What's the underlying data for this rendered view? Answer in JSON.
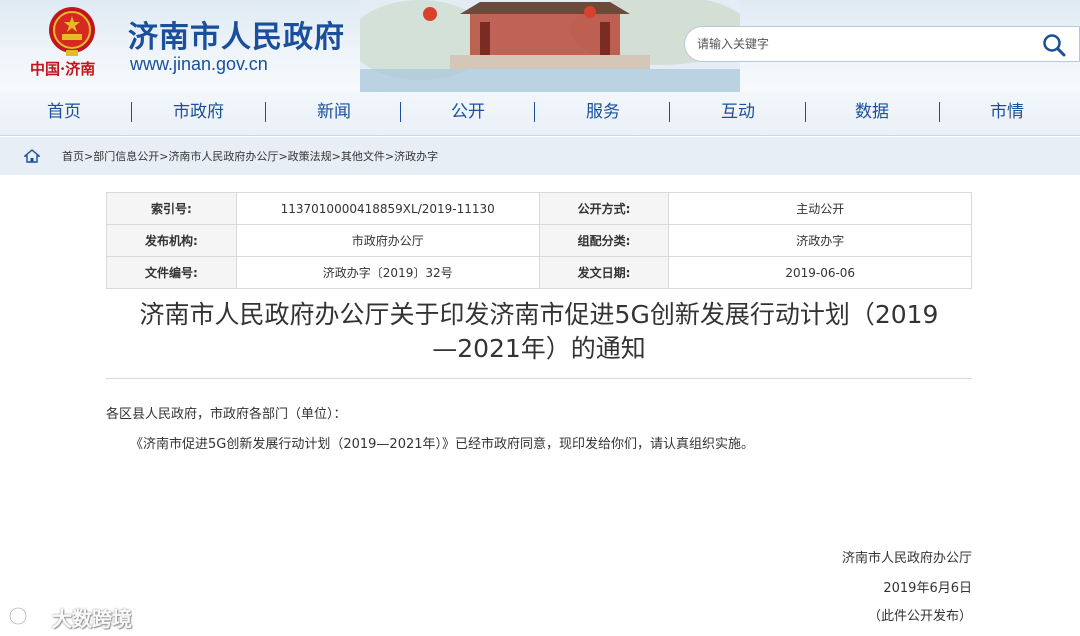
{
  "header": {
    "logo_text": "中国·济南",
    "site_title": "济南市人民政府",
    "site_url": "www.jinan.gov.cn"
  },
  "search": {
    "placeholder": "请输入关键字"
  },
  "nav": {
    "items": [
      {
        "label": "首页"
      },
      {
        "label": "市政府"
      },
      {
        "label": "新闻"
      },
      {
        "label": "公开"
      },
      {
        "label": "服务"
      },
      {
        "label": "互动"
      },
      {
        "label": "数据"
      },
      {
        "label": "市情"
      }
    ]
  },
  "breadcrumb": {
    "items": [
      "首页",
      "部门信息公开",
      "济南市人民政府办公厅",
      "政策法规",
      "其他文件",
      "济政办字"
    ],
    "separator": ">"
  },
  "meta": {
    "rows": [
      {
        "l1": "索引号:",
        "v1": "113701000041885 9XL/2019-11130",
        "l2": "公开方式:",
        "v2": "主动公开"
      },
      {
        "l1": "发布机构:",
        "v1": "市政府办公厅",
        "l2": "组配分类:",
        "v2": "济政办字"
      },
      {
        "l1": "文件编号:",
        "v1": "济政办字〔2019〕32号",
        "l2": "发文日期:",
        "v2": "2019-06-06"
      }
    ]
  },
  "article": {
    "title_line1": "济南市人民政府办公厅关于印发济南市促进5G创新发展行动计划（2019",
    "title_line2": "—2021年）的通知",
    "salutation": "各区县人民政府，市政府各部门（单位）：",
    "body": "《济南市促进5G创新发展行动计划（2019—2021年）》已经市政府同意，现印发给你们，请认真组织实施。",
    "signer": "济南市人民政府办公厅",
    "date": "2019年6月6日",
    "note": "（此件公开发布）"
  },
  "watermark": {
    "text": "大数跨境"
  },
  "colors": {
    "brand_blue": "#1a4f9c",
    "emblem_red": "#c0161d",
    "gold": "#e8b929"
  }
}
